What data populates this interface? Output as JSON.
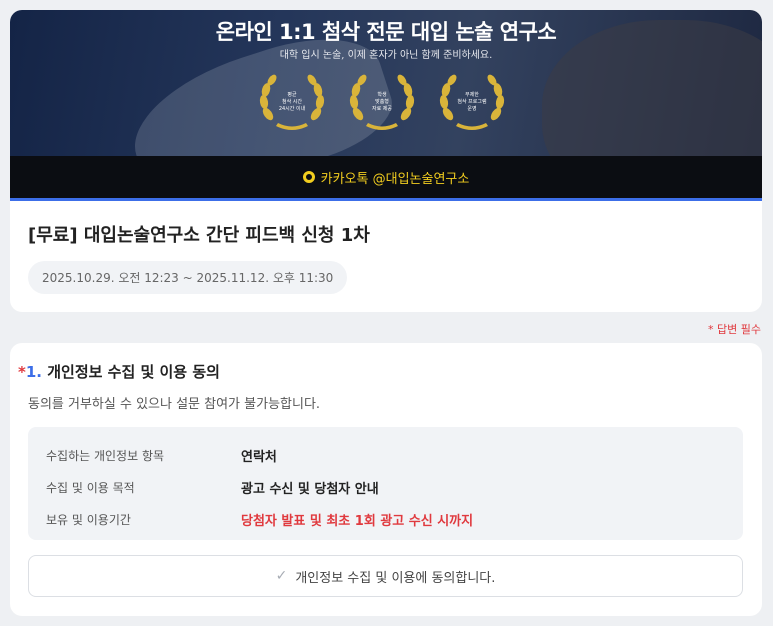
{
  "banner": {
    "title": "온라인 1:1 첨삭 전문 대입 논술 연구소",
    "subtitle": "대학 입시 논술, 이제 혼자가 아닌 함께 준비하세요.",
    "badges": [
      {
        "line1": "평균",
        "line2": "첨삭 시간",
        "line3": "24시간 이내"
      },
      {
        "line1": "학생",
        "line2": "맞춤형",
        "line3": "자료 제공"
      },
      {
        "line1": "무제한",
        "line2": "첨삭 프로그램",
        "line3": "운영"
      }
    ],
    "kakao_text": "카카오톡 @대입논술연구소",
    "accent_color": "#3c6ee8",
    "kakao_color": "#f2cd1f",
    "laurel_color": "#d9b43a"
  },
  "form": {
    "title": "[무료] 대입논술연구소 간단 피드백 신청 1차",
    "date_range": "2025.10.29. 오전 12:23 ~ 2025.11.12. 오후 11:30"
  },
  "required_note": "* 답변 필수",
  "question": {
    "star": "*",
    "number": "1.",
    "title": "개인정보 수집 및 이용 동의",
    "description": "동의를 거부하실 수 있으나 설문 참여가 불가능합니다.",
    "rows": [
      {
        "key": "수집하는 개인정보 항목",
        "value": "연락처"
      },
      {
        "key": "수집 및 이용 목적",
        "value": "광고 수신 및 당첨자 안내"
      },
      {
        "key": "보유 및 이용기간",
        "value": "당첨자 발표 및 최초 1회 광고 수신 시까지"
      }
    ],
    "agree_label": "개인정보 수집 및 이용에 동의합니다.",
    "check_icon": "✓"
  }
}
